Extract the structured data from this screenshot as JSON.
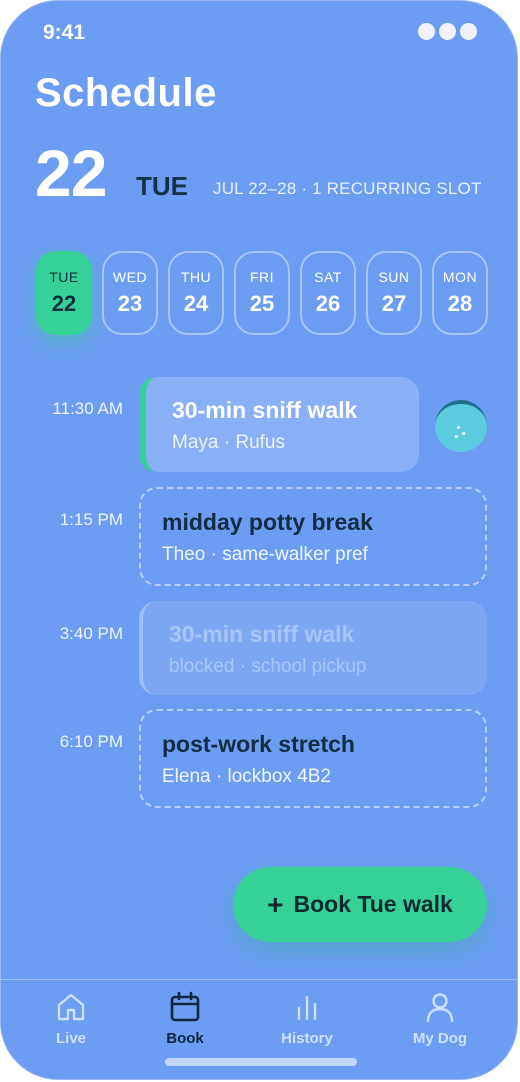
{
  "status_bar": {
    "time": "9:41"
  },
  "header": {
    "title": "Schedule",
    "date_number": "22",
    "weekday": "TUE",
    "summary": "JUL 22–28 · 1 RECURRING SLOT"
  },
  "days": [
    {
      "name": "TUE",
      "num": "22",
      "selected": true
    },
    {
      "name": "WED",
      "num": "23"
    },
    {
      "name": "THU",
      "num": "24"
    },
    {
      "name": "FRI",
      "num": "25"
    },
    {
      "name": "SAT",
      "num": "26"
    },
    {
      "name": "SUN",
      "num": "27"
    },
    {
      "name": "MON",
      "num": "28"
    }
  ],
  "slots": [
    {
      "time": "11:30 AM",
      "title": "30-min sniff walk",
      "subtitle": "Maya · Rufus",
      "state": "booked"
    },
    {
      "time": "1:15 PM",
      "title": "midday potty break",
      "subtitle": "Theo · same-walker pref",
      "state": "open"
    },
    {
      "time": "3:40 PM",
      "title": "30-min sniff walk",
      "subtitle": "blocked · school pickup",
      "state": "blocked"
    },
    {
      "time": "6:10 PM",
      "title": "post-work stretch",
      "subtitle": "Elena · lockbox 4B2",
      "state": "open"
    }
  ],
  "fab": {
    "plus": "+",
    "label": "Book Tue walk"
  },
  "tabs": [
    {
      "label": "Live",
      "icon": "home-icon"
    },
    {
      "label": "Book",
      "icon": "calendar-icon",
      "active": true
    },
    {
      "label": "History",
      "icon": "bar-chart-icon"
    },
    {
      "label": "My Dog",
      "icon": "person-icon"
    }
  ],
  "colors": {
    "background": "#6c9df2",
    "accent": "#36d197",
    "dark_text": "#13324a"
  }
}
